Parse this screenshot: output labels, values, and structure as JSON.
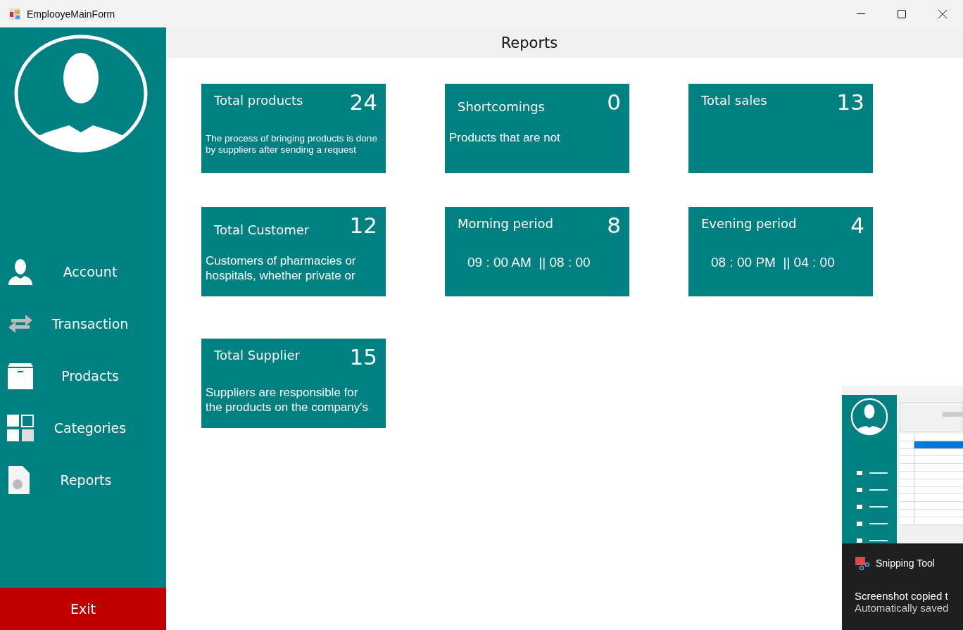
{
  "window": {
    "title": "EmplooyeMainForm"
  },
  "sidebar": {
    "items": [
      {
        "label": "Account",
        "kind": "account"
      },
      {
        "label": "Transaction",
        "kind": "transaction"
      },
      {
        "label": "Prodacts",
        "kind": "products"
      },
      {
        "label": "Categories",
        "kind": "categories"
      },
      {
        "label": "Reports",
        "kind": "reports"
      }
    ],
    "exit": "Exit"
  },
  "header": "Reports",
  "cards": [
    {
      "title": "Total products",
      "value": "24",
      "description": "The process of bringing products is done by suppliers after sending a request",
      "kind": "note"
    },
    {
      "title": "Shortcomings",
      "value": "0",
      "description": "Products that are not",
      "kind": "text"
    },
    {
      "title": "Total sales",
      "value": "13"
    },
    {
      "title": "Total Customer",
      "value": "12",
      "description": "Customers of pharmacies or hospitals, whether private or",
      "kind": "text"
    },
    {
      "title": "Morning period",
      "value": "8",
      "description": "09 : 00 AM  || 08 : 00",
      "kind": "time"
    },
    {
      "title": "Evening period",
      "value": "4",
      "description": "08 : 00 PM  || 04 : 00",
      "kind": "time"
    },
    {
      "title": "Total Supplier",
      "value": "15",
      "description": "Suppliers are responsible for the products on the company's",
      "kind": "text"
    }
  ],
  "notification": {
    "app": "Snipping Tool",
    "message": "Screenshot copied t",
    "detail": "Automatically saved"
  }
}
